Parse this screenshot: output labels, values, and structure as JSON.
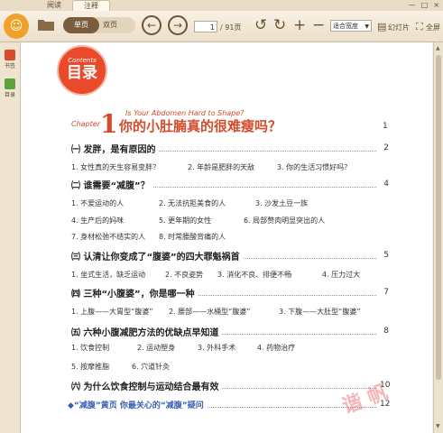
{
  "tabs": [
    "阅读",
    "注释"
  ],
  "window": {
    "minimize": "—",
    "maximize": "□",
    "close": "×"
  },
  "toolbar": {
    "mode_single": "单页",
    "mode_double": "双页",
    "page_current": "1",
    "page_total": "/ 91页",
    "zoom": "适合宽度",
    "slideshow": "幻灯片",
    "fullscreen": "全屏"
  },
  "sidebar": {
    "bookmarks": "书签",
    "toc": "目录"
  },
  "doc": {
    "contents_en": "Contents",
    "contents_cn": "目录",
    "chapter_word": "Chapter",
    "chapter_num": "1",
    "chapter_subtitle": "Is Your Abdomen Hard to Shape?",
    "chapter_title": "你的小肚腩真的很难瘦吗？",
    "chapter_page": "1",
    "sections": [
      {
        "title": "㈠ 发胖，是有原因的",
        "page": "2"
      },
      {
        "title": "㈡ 谁需要“减腹”？",
        "page": "4"
      },
      {
        "title": "㈢ 认清让你变成了“腹婆”的四大罪魁祸首",
        "page": "5"
      },
      {
        "title": "㈣ 三种“小腹婆”，你是哪一种",
        "page": "7"
      },
      {
        "title": "㈤ 六种小腹减肥方法的优缺点早知道",
        "page": "8"
      },
      {
        "title": "㈥ 为什么饮食控制与运动结合最有效",
        "page": "10"
      }
    ],
    "subs": {
      "s1": [
        "1. 女性真的天生容易变胖？",
        "2. 年龄是肥胖的天敌",
        "3. 你的生活习惯好吗？"
      ],
      "s2a": [
        "1. 不爱运动的人",
        "2. 无法抗拒美食的人",
        "3. 沙发土豆一族"
      ],
      "s2b": [
        "4. 生产后的妈咪",
        "5. 更年期的女性",
        "6. 局部赘肉明显突出的人"
      ],
      "s2c": [
        "7. 身材松弛不结实的人",
        "8. 时常腰酸背痛的人"
      ],
      "s3": [
        "1. 坐式生活，缺乏运动",
        "2. 不良姿势",
        "3. 消化不良、排便不畅",
        "4. 压力过大"
      ],
      "s4": [
        "1. 上腹——大胃型“腹婆”",
        "2. 腰部——水桶型“腹婆”",
        "3. 下腹——大肚型“腹婆”"
      ],
      "s5a": [
        "1. 饮食控制",
        "2. 运动塑身",
        "3. 外科手术",
        "4. 药物治疗"
      ],
      "s5b": [
        "5. 按摩推脂",
        "6. 穴道针灸"
      ]
    },
    "last_entry": {
      "title": "◆“减腹”黄页  你最关心的“减腹”疑问",
      "page": "12"
    },
    "stamp": "谐 帆"
  }
}
